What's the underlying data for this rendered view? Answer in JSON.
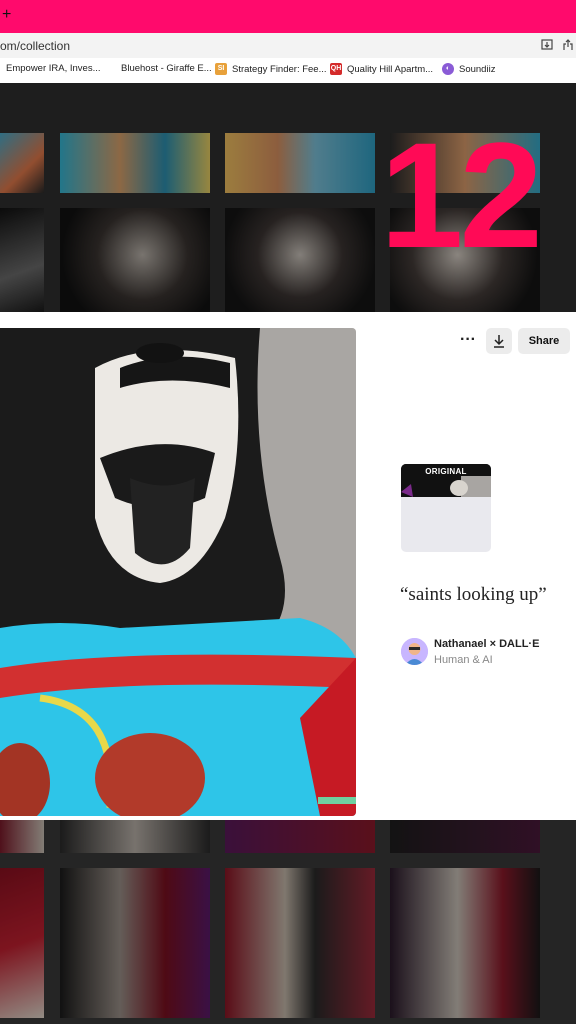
{
  "browser": {
    "url": "om/collection",
    "new_tab_symbol": "+",
    "bookmarks": [
      {
        "label": "Empower IRA, Inves...",
        "icon": "empower-icon"
      },
      {
        "label": "Bluehost - Giraffe E...",
        "icon": "bluehost-icon"
      },
      {
        "label": "Strategy Finder: Fee...",
        "icon": "strategy-finder-icon"
      },
      {
        "label": "Quality Hill Apartm...",
        "icon": "quality-hill-icon"
      },
      {
        "label": "Soundiiz",
        "icon": "soundiiz-icon"
      }
    ]
  },
  "annotation": {
    "number": "12",
    "color": "#ff0a56"
  },
  "detail": {
    "more_label": "···",
    "download_icon": "download-icon",
    "share_label": "Share",
    "original_label": "ORIGINAL",
    "prompt": "“saints looking up”",
    "author": "Nathanael × DALL·E",
    "author_sub": "Human & AI"
  },
  "colors": {
    "accent": "#ff0a6c",
    "panel": "#ffffff",
    "backdrop": "#2b2b2b"
  }
}
